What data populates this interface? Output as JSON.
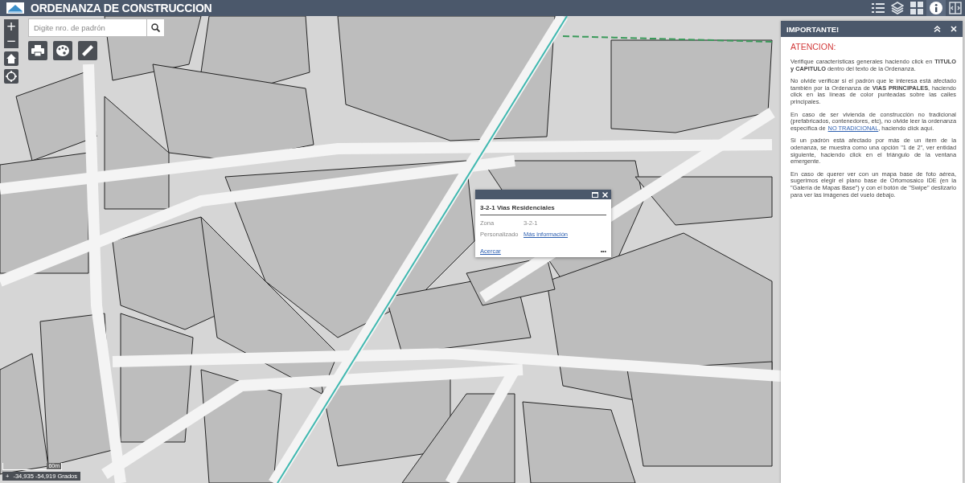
{
  "header": {
    "title": "ORDENANZA DE CONSTRUCCION",
    "tools": [
      {
        "kind": "legend",
        "selected": false
      },
      {
        "kind": "layers",
        "selected": false
      },
      {
        "kind": "basemap",
        "selected": false
      },
      {
        "kind": "info",
        "selected": true
      },
      {
        "kind": "swipe",
        "selected": false
      }
    ]
  },
  "zoom": {
    "in": "+",
    "out": "−"
  },
  "search": {
    "placeholder": "Digite nro. de padrón"
  },
  "map_tools": [
    {
      "kind": "print"
    },
    {
      "kind": "palette"
    },
    {
      "kind": "measure"
    }
  ],
  "nav_tools": [
    {
      "kind": "home"
    },
    {
      "kind": "locate"
    }
  ],
  "popup": {
    "title": "3-2-1 Vias Residenciales",
    "fields": [
      {
        "label": "Zona",
        "value": "3-2-1",
        "kind": "text"
      },
      {
        "label": "Personalizado",
        "value": "Más información",
        "kind": "link"
      }
    ],
    "zoom_link": "Acercar",
    "more": "•••"
  },
  "scale": {
    "label": "60m"
  },
  "coordinates": {
    "toggle": "+",
    "text": "-34,935 -54,919 Grados"
  },
  "panel": {
    "title": "IMPORTANTE!",
    "heading": "ATENCION:",
    "paragraphs": [
      {
        "text": "Verifique características generales haciendo click en **TITULO y CAPITULO** dentro del texto de la Ordenanza."
      },
      {
        "text": "No olvide verificar si el padrón que le interesa está afectado también por la Ordenanza de **VIAS PRINCIPALES**, haciendo click en las líneas de color punteadas sobre las calles principales."
      },
      {
        "text": "En caso de ser vivienda de construcción no tradicional (prefabricados, contenedores, etc), no olvide leer la ordenanza específica de",
        "link": "NO TRADICIONAL",
        "after": ", haciendo click aquí."
      },
      {
        "text": "Si un padrón está afectado por más de un ítem de la odenanza, se muestra como una opción \"1 de 2\", ver entidad siguiente, haciendo click en el triángulo de la ventana emergente."
      },
      {
        "text": "En caso de querer ver con un mapa base de foto aérea, sugerimos elegir el plano base de Ortomosaico IDE (en la \"Galería de Mapas Base\") y con el botón de \"Swipe\" deslizarlo para ver las imágenes del vuelo debajo."
      }
    ]
  }
}
